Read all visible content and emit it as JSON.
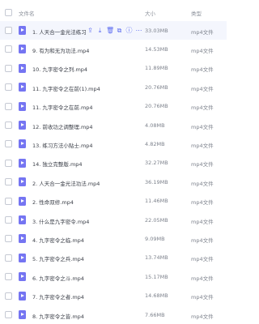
{
  "header": {
    "name_label": "文件名",
    "size_label": "大小",
    "type_label": "类型"
  },
  "row_actions": [
    "share-icon",
    "download-icon",
    "delete-icon",
    "copy-icon",
    "info-icon",
    "more-icon"
  ],
  "files": [
    {
      "name": "1. 人天合一金光法练习.mp4",
      "size": "33.03MB",
      "type": "mp4文件"
    },
    {
      "name": "9. 有为和无为功法.mp4",
      "size": "14.53MB",
      "type": "mp4文件"
    },
    {
      "name": "10. 九字密令之列.mp4",
      "size": "11.89MB",
      "type": "mp4文件"
    },
    {
      "name": "11. 九字密令之在前(1).mp4",
      "size": "20.76MB",
      "type": "mp4文件"
    },
    {
      "name": "11. 九字密令之在前.mp4",
      "size": "20.76MB",
      "type": "mp4文件"
    },
    {
      "name": "12. 前收功之调整理.mp4",
      "size": "4.08MB",
      "type": "mp4文件"
    },
    {
      "name": "13. 练习方法小贴士.mp4",
      "size": "4.82MB",
      "type": "mp4文件"
    },
    {
      "name": "14. 独立完整版.mp4",
      "size": "32.27MB",
      "type": "mp4文件"
    },
    {
      "name": "2. 人天合一金光法功法.mp4",
      "size": "36.19MB",
      "type": "mp4文件"
    },
    {
      "name": "2. 性命双修.mp4",
      "size": "11.46MB",
      "type": "mp4文件"
    },
    {
      "name": "3. 什么是九字密令.mp4",
      "size": "22.05MB",
      "type": "mp4文件"
    },
    {
      "name": "4. 九字密令之临.mp4",
      "size": "9.09MB",
      "type": "mp4文件"
    },
    {
      "name": "5. 九字密令之兵.mp4",
      "size": "13.74MB",
      "type": "mp4文件"
    },
    {
      "name": "6. 九字密令之斗.mp4",
      "size": "15.17MB",
      "type": "mp4文件"
    },
    {
      "name": "7. 九字密令之者.mp4",
      "size": "14.68MB",
      "type": "mp4文件"
    },
    {
      "name": "8. 九字密令之皆.mp4",
      "size": "7.66MB",
      "type": "mp4文件"
    }
  ],
  "colors": {
    "accent": "#5b6bf0",
    "icon": "#7575f2",
    "highlight_row": "#f4f6fd"
  }
}
